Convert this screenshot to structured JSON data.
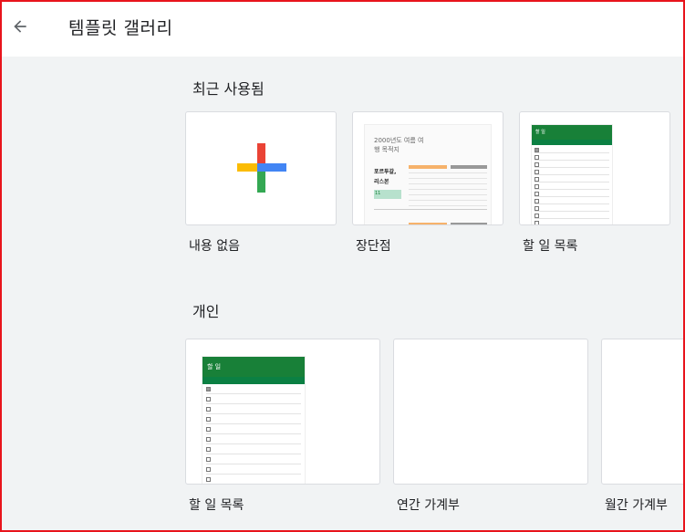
{
  "header": {
    "title": "템플릿 갤러리",
    "back_icon": "arrow-back-icon"
  },
  "recent": {
    "section_title": "최근 사용됨",
    "cards": [
      {
        "label": "내용 없음",
        "thumbnail": "blank-plus"
      },
      {
        "label": "장단점",
        "thumbnail": "travel-checklist",
        "thumb_text": {
          "heading": "2000년도 여름 여행 목적지",
          "left1": "포르투갈,",
          "left2": "리스본",
          "num": "11"
        }
      },
      {
        "label": "할 일 목록",
        "thumbnail": "todo-list",
        "thumb_text": {
          "heading": "할 일"
        }
      }
    ]
  },
  "personal": {
    "section_title": "개인",
    "cards": [
      {
        "label": "할 일 목록",
        "thumbnail": "todo-list-large",
        "thumb_text": {
          "heading": "할 일"
        }
      },
      {
        "label": "연간 가계부",
        "thumbnail": "blank"
      },
      {
        "label": "월간 가계부",
        "thumbnail": "blank"
      }
    ]
  },
  "colors": {
    "accent_green": "#188038",
    "plus_blue": "#4285f4",
    "plus_red": "#ea4335",
    "plus_yellow": "#fbbc04",
    "plus_green": "#34a853",
    "frame_red": "#e8141c"
  }
}
